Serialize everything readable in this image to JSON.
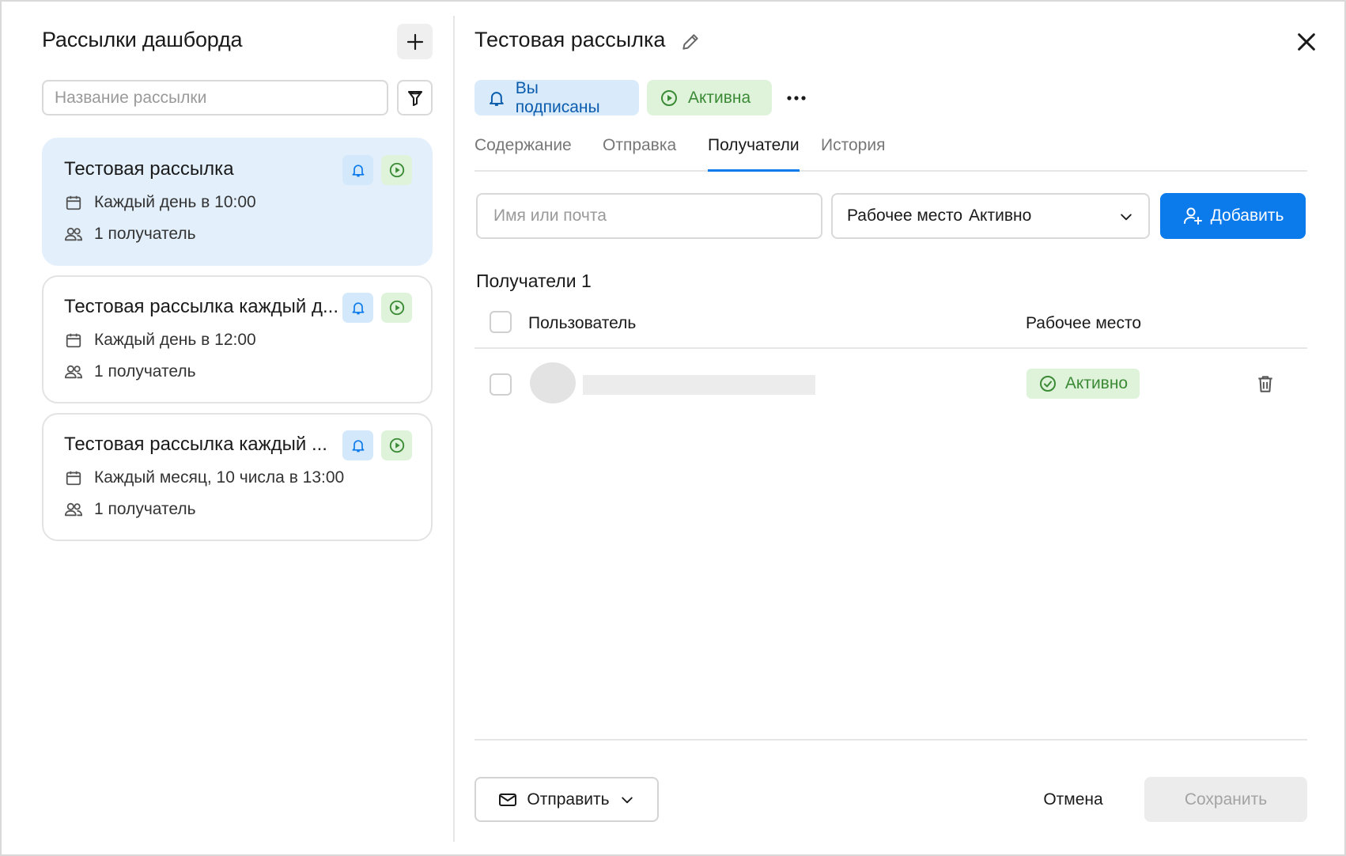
{
  "sidebar": {
    "title": "Рассылки дашборда",
    "search_placeholder": "Название рассылки",
    "cards": [
      {
        "title": "Тестовая рассылка",
        "schedule": "Каждый день в 10:00",
        "recipients": "1 получатель",
        "active": true
      },
      {
        "title": "Тестовая рассылка каждый д...",
        "schedule": "Каждый день в 12:00",
        "recipients": "1 получатель",
        "active": false
      },
      {
        "title": "Тестовая рассылка каждый ...",
        "schedule": "Каждый месяц, 10 числа в 13:00",
        "recipients": "1 получатель",
        "active": false
      }
    ]
  },
  "detail": {
    "title": "Тестовая рассылка",
    "chips": {
      "subscribed": "Вы подписаны",
      "status": "Активна"
    },
    "tabs": [
      {
        "label": "Содержание",
        "active": false
      },
      {
        "label": "Отправка",
        "active": false
      },
      {
        "label": "Получатели",
        "active": true
      },
      {
        "label": "История",
        "active": false
      }
    ],
    "name_placeholder": "Имя или почта",
    "workspace_filter": {
      "label": "Рабочее место",
      "value": "Активно"
    },
    "add_label": "Добавить",
    "recipients_count_label": "Получатели 1",
    "table": {
      "col_user": "Пользователь",
      "col_workspace": "Рабочее место",
      "rows": [
        {
          "workspace_status": "Активно"
        }
      ]
    },
    "footer": {
      "send_label": "Отправить",
      "cancel_label": "Отмена",
      "save_label": "Сохранить"
    }
  },
  "colors": {
    "accent": "#0b7aeb",
    "active_card_bg": "#e3f0fc",
    "success_bg": "#dff3db",
    "success_fg": "#3b8a35",
    "info_bg": "#d9ebfb"
  }
}
